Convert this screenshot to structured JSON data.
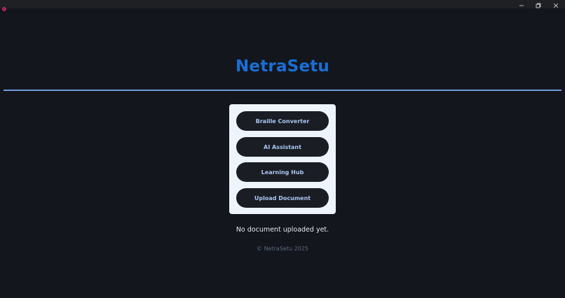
{
  "window": {
    "icon": "app-logo-icon",
    "controls": {
      "minimize_icon": "minimize-icon",
      "maximize_icon": "restore-icon",
      "close_icon": "close-icon"
    }
  },
  "header": {
    "title": "NetraSetu",
    "title_color": "#1a6fd6",
    "rule_color": "#6f9ad8"
  },
  "menu": {
    "buttons": [
      {
        "label": "Braille Converter"
      },
      {
        "label": "AI Assistant"
      },
      {
        "label": "Learning Hub"
      },
      {
        "label": "Upload Document"
      }
    ]
  },
  "status": {
    "text": "No document uploaded yet."
  },
  "footer": {
    "text": "© NetraSetu 2025"
  },
  "colors": {
    "background": "#13161d",
    "card": "#eef4fc",
    "button": "#1b1d24",
    "button_text": "#a9c6f2"
  }
}
